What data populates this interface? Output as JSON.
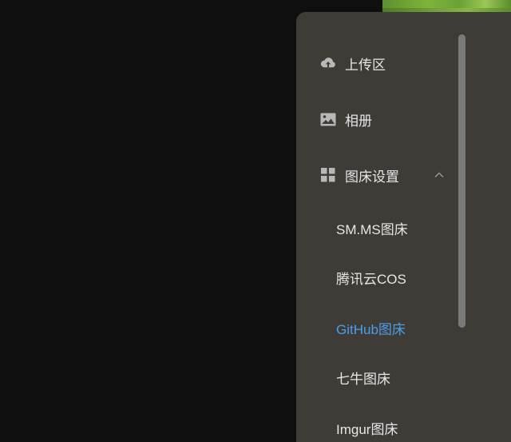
{
  "colors": {
    "panel_bg": "#3f3c38",
    "page_bg": "#0f0f0f",
    "text": "#e6e6e6",
    "active": "#4a9eea",
    "icon": "#b8b8b8"
  },
  "menu": {
    "items": [
      {
        "label": "上传区",
        "icon": "cloud-upload-icon"
      },
      {
        "label": "相册",
        "icon": "image-icon"
      },
      {
        "label": "图床设置",
        "icon": "grid-icon",
        "expanded": true
      }
    ],
    "submenu": [
      {
        "label": "SM.MS图床",
        "active": false
      },
      {
        "label": "腾讯云COS",
        "active": false
      },
      {
        "label": "GitHub图床",
        "active": true
      },
      {
        "label": "七牛图床",
        "active": false
      },
      {
        "label": "Imgur图床",
        "active": false
      }
    ]
  }
}
